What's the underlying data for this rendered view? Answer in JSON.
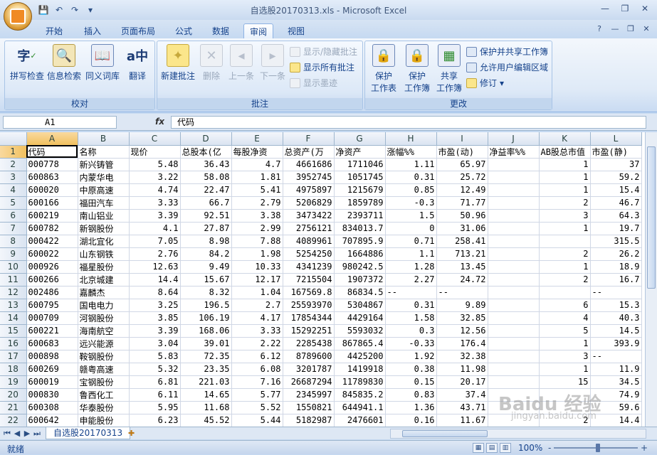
{
  "window": {
    "title": "自选股20170313.xls - Microsoft Excel"
  },
  "qat": {
    "save_icon": "save-icon",
    "undo_icon": "undo-icon",
    "redo_icon": "redo-icon"
  },
  "tabs": [
    "开始",
    "插入",
    "页面布局",
    "公式",
    "数据",
    "审阅",
    "视图"
  ],
  "active_tab": "审阅",
  "ribbon": {
    "proofing": {
      "label": "校对",
      "spell": "拼写检查",
      "research": "信息检索",
      "thesaurus": "同义词库",
      "translate": "翻译"
    },
    "comments": {
      "label": "批注",
      "new": "新建批注",
      "delete": "删除",
      "prev": "上一条",
      "next": "下一条",
      "show_hide": "显示/隐藏批注",
      "show_all": "显示所有批注",
      "show_ink": "显示墨迹"
    },
    "changes": {
      "label": "更改",
      "protect_sheet_1": "保护",
      "protect_sheet_2": "工作表",
      "protect_wb_1": "保护",
      "protect_wb_2": "工作簿",
      "share_wb_1": "共享",
      "share_wb_2": "工作簿",
      "protect_share": "保护并共享工作簿",
      "allow_edit": "允许用户编辑区域",
      "track": "修订"
    }
  },
  "formula_bar": {
    "cell_ref": "A1",
    "fx": "fx",
    "content": "代码"
  },
  "columns": [
    "A",
    "B",
    "C",
    "D",
    "E",
    "F",
    "G",
    "H",
    "I",
    "J",
    "K",
    "L"
  ],
  "rows": [
    [
      "代码",
      "名称",
      "现价",
      "总股本(亿",
      "每股净资",
      "总资产(万",
      "净资产",
      "涨幅%%",
      "市盈(动)",
      "净益率%%",
      "AB股总市值",
      "市盈(静)"
    ],
    [
      "000778",
      "新兴铸管",
      "5.48",
      "36.43",
      "4.7",
      "4661686",
      "1711046",
      "1.11",
      "65.97",
      "",
      "1",
      "37"
    ],
    [
      "600863",
      "内蒙华电",
      "3.22",
      "58.08",
      "1.81",
      "3952745",
      "1051745",
      "0.31",
      "25.72",
      "",
      "1",
      "59.2"
    ],
    [
      "600020",
      "中原高速",
      "4.74",
      "22.47",
      "5.41",
      "4975897",
      "1215679",
      "0.85",
      "12.49",
      "",
      "1",
      "15.4"
    ],
    [
      "600166",
      "福田汽车",
      "3.33",
      "66.7",
      "2.79",
      "5206829",
      "1859789",
      "-0.3",
      "71.77",
      "",
      "2",
      "46.7"
    ],
    [
      "600219",
      "南山铝业",
      "3.39",
      "92.51",
      "3.38",
      "3473422",
      "2393711",
      "1.5",
      "50.96",
      "",
      "3",
      "64.3"
    ],
    [
      "600782",
      "新钢股份",
      "4.1",
      "27.87",
      "2.99",
      "2756121",
      "834013.7",
      "0",
      "31.06",
      "",
      "1",
      "19.7"
    ],
    [
      "000422",
      "湖北宜化",
      "7.05",
      "8.98",
      "7.88",
      "4089961",
      "707895.9",
      "0.71",
      "258.41",
      "",
      "",
      "315.5"
    ],
    [
      "600022",
      "山东钢铁",
      "2.76",
      "84.2",
      "1.98",
      "5254250",
      "1664886",
      "1.1",
      "713.21",
      "",
      "2",
      "26.2"
    ],
    [
      "000926",
      "福星股份",
      "12.63",
      "9.49",
      "10.33",
      "4341239",
      "980242.5",
      "1.28",
      "13.45",
      "",
      "1",
      "18.9"
    ],
    [
      "600266",
      "北京城建",
      "14.4",
      "15.67",
      "12.17",
      "7215504",
      "1907372",
      "2.27",
      "24.72",
      "",
      "2",
      "16.7"
    ],
    [
      "002486",
      "嘉麟杰",
      "8.64",
      "8.32",
      "1.04",
      "167569.8",
      "86834.5",
      "--",
      "--",
      "",
      "",
      "--"
    ],
    [
      "600795",
      "国电电力",
      "3.25",
      "196.5",
      "2.7",
      "25593970",
      "5304867",
      "0.31",
      "9.89",
      "",
      "6",
      "15.3"
    ],
    [
      "000709",
      "河钢股份",
      "3.85",
      "106.19",
      "4.17",
      "17854344",
      "4429164",
      "1.58",
      "32.85",
      "",
      "4",
      "40.3"
    ],
    [
      "600221",
      "海南航空",
      "3.39",
      "168.06",
      "3.33",
      "15292251",
      "5593032",
      "0.3",
      "12.56",
      "",
      "5",
      "14.5"
    ],
    [
      "600683",
      "远兴能源",
      "3.04",
      "39.01",
      "2.22",
      "2285438",
      "867865.4",
      "-0.33",
      "176.4",
      "",
      "1",
      "393.9"
    ],
    [
      "000898",
      "鞍钢股份",
      "5.83",
      "72.35",
      "6.12",
      "8789600",
      "4425200",
      "1.92",
      "32.38",
      "",
      "3",
      "--"
    ],
    [
      "600269",
      "赣粤高速",
      "5.32",
      "23.35",
      "6.08",
      "3201787",
      "1419918",
      "0.38",
      "11.98",
      "",
      "1",
      "11.9"
    ],
    [
      "600019",
      "宝钢股份",
      "6.81",
      "221.03",
      "7.16",
      "26687294",
      "11789830",
      "0.15",
      "20.17",
      "",
      "15",
      "34.5"
    ],
    [
      "000830",
      "鲁西化工",
      "6.11",
      "14.65",
      "5.77",
      "2345997",
      "845835.2",
      "0.83",
      "37.4",
      "",
      "",
      "74.9"
    ],
    [
      "600308",
      "华泰股份",
      "5.95",
      "11.68",
      "5.52",
      "1550821",
      "644941.1",
      "1.36",
      "43.71",
      "",
      "",
      "59.6"
    ],
    [
      "600642",
      "申能股份",
      "6.23",
      "45.52",
      "5.44",
      "5182987",
      "2476601",
      "0.16",
      "11.67",
      "",
      "2",
      "14.4"
    ]
  ],
  "sheet": {
    "tab": "自选股20170313"
  },
  "status": {
    "ready": "就绪",
    "zoom": "100%",
    "minus": "-",
    "plus": "+"
  },
  "watermark": {
    "brand": "Baidu 经验",
    "url": "jingyan.baidu.com"
  }
}
